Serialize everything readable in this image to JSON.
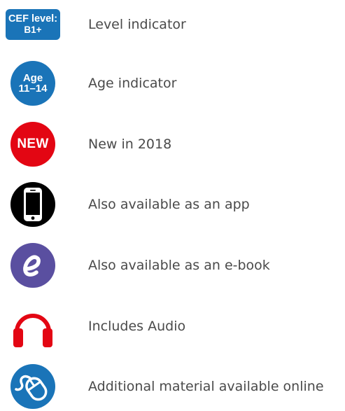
{
  "badges": {
    "cef_line1": "CEF level:",
    "cef_line2": "B1+",
    "age_line1": "Age",
    "age_line2": "11–14",
    "new_text": "NEW"
  },
  "legend": {
    "items": [
      {
        "icon": "cef-level-badge",
        "label": "Level indicator"
      },
      {
        "icon": "age-badge",
        "label": "Age indicator"
      },
      {
        "icon": "new-badge",
        "label": "New in 2018"
      },
      {
        "icon": "smartphone-icon",
        "label": "Also available as an app"
      },
      {
        "icon": "ebook-e-icon",
        "label": "Also available as an e-book"
      },
      {
        "icon": "headphones-icon",
        "label": "Includes Audio"
      },
      {
        "icon": "mouse-online-icon",
        "label": "Additional material available online"
      }
    ]
  },
  "colors": {
    "blue": "#1a74b8",
    "red": "#e30613",
    "black": "#000000",
    "purple": "#5a4fa0",
    "text": "#4a4a4a"
  }
}
